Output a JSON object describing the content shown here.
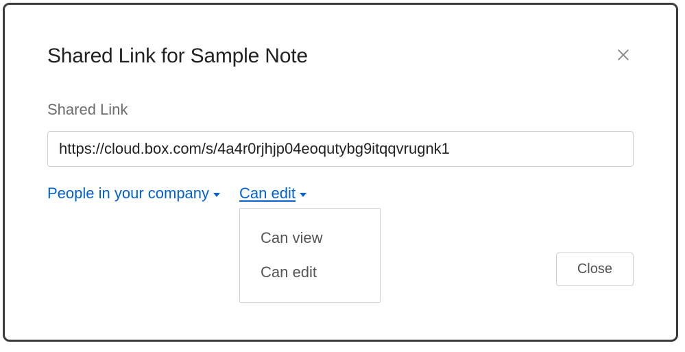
{
  "modal": {
    "title": "Shared Link for Sample Note",
    "field_label": "Shared Link",
    "link_value": "https://cloud.box.com/s/4a4r0rjhjp04eoqutybg9itqqvrugnk1",
    "scope": {
      "selected_label": "People in your company"
    },
    "permission": {
      "selected_label": "Can edit",
      "options": {
        "0": {
          "label": "Can view"
        },
        "1": {
          "label": "Can edit"
        }
      }
    },
    "close_button_label": "Close"
  }
}
